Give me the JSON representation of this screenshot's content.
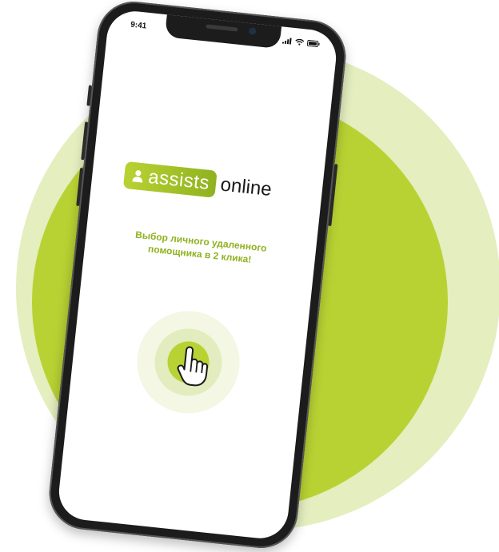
{
  "colors": {
    "accent": "#b9d233",
    "accent_dark": "#8fb21f",
    "circle_outer": "#e4eebf",
    "circle_inner": "#b9d233",
    "tap_ring_outer": "#f3f7e3",
    "tap_ring_mid": "#e2ecbe",
    "tap_core": "#b9d233",
    "tagline": "#8fb21f"
  },
  "status_bar": {
    "time": "9:41",
    "icons": [
      "signal-icon",
      "wifi-icon",
      "battery-icon"
    ]
  },
  "logo": {
    "icon": "user-icon",
    "pill_text": "assists",
    "text": "online"
  },
  "tagline": {
    "line1": "Выбор личного удаленного",
    "line2": "помощника в 2 клика!"
  },
  "tap_target": {
    "icon": "pointer-hand-icon"
  }
}
